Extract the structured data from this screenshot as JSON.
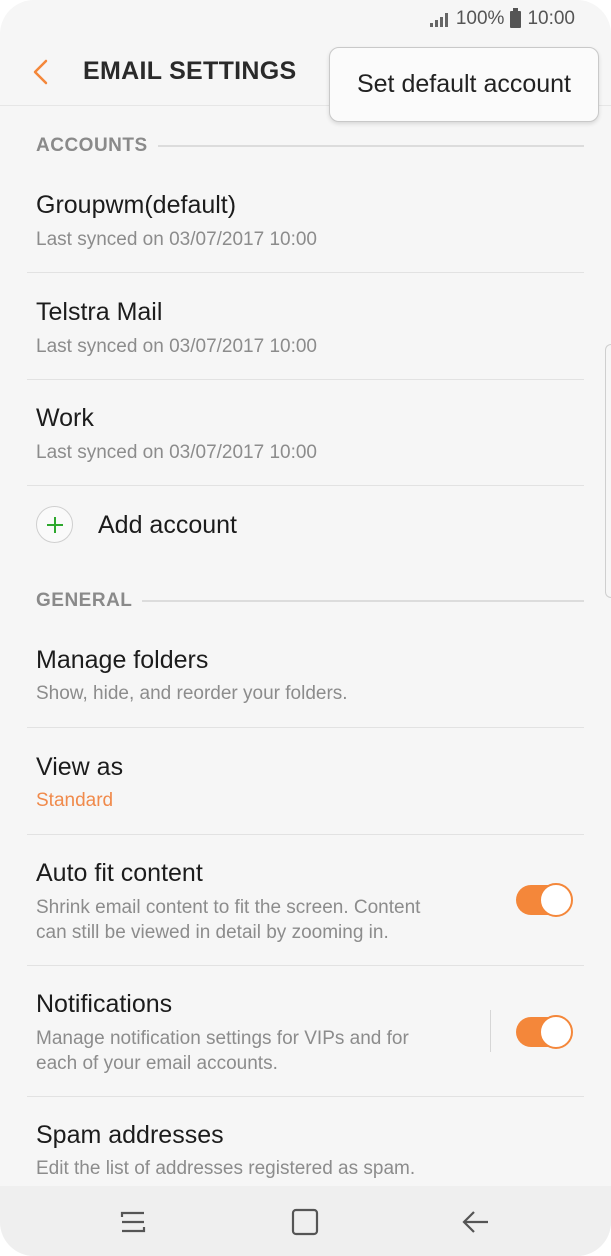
{
  "status_bar": {
    "battery": "100%",
    "time": "10:00"
  },
  "header": {
    "title": "EMAIL SETTINGS",
    "back_icon": "chevron-left-icon"
  },
  "popup_menu": {
    "items": [
      {
        "label": "Set default account"
      }
    ]
  },
  "accounts": {
    "section_label": "ACCOUNTS",
    "items": [
      {
        "name": "Groupwm(default)",
        "subtitle": "Last synced on 03/07/2017  10:00"
      },
      {
        "name": "Telstra Mail",
        "subtitle": "Last synced on 03/07/2017  10:00"
      },
      {
        "name": "Work",
        "subtitle": "Last synced on 03/07/2017  10:00"
      }
    ],
    "add_label": "Add account"
  },
  "general": {
    "section_label": "GENERAL",
    "manage_folders": {
      "title": "Manage folders",
      "subtitle": "Show, hide, and reorder your folders."
    },
    "view_as": {
      "title": "View as",
      "value": "Standard"
    },
    "auto_fit": {
      "title": "Auto fit content",
      "subtitle_line1": "Shrink email content to fit the screen. Content",
      "subtitle_line2": "can still be viewed in detail by zooming in.",
      "enabled": true
    },
    "notifications": {
      "title": "Notifications",
      "subtitle_line1": "Manage notification settings for VIPs and for",
      "subtitle_line2": "each of your email accounts.",
      "enabled": true
    },
    "spam": {
      "title": "Spam addresses",
      "subtitle": "Edit the list of addresses registered as spam."
    }
  },
  "colors": {
    "accent": "#f4873a",
    "add_icon": "#2ea82e",
    "subtext": "#8c8c8c"
  },
  "nav_bar": {
    "icons": [
      "recent-apps-icon",
      "home-icon",
      "back-icon"
    ]
  }
}
